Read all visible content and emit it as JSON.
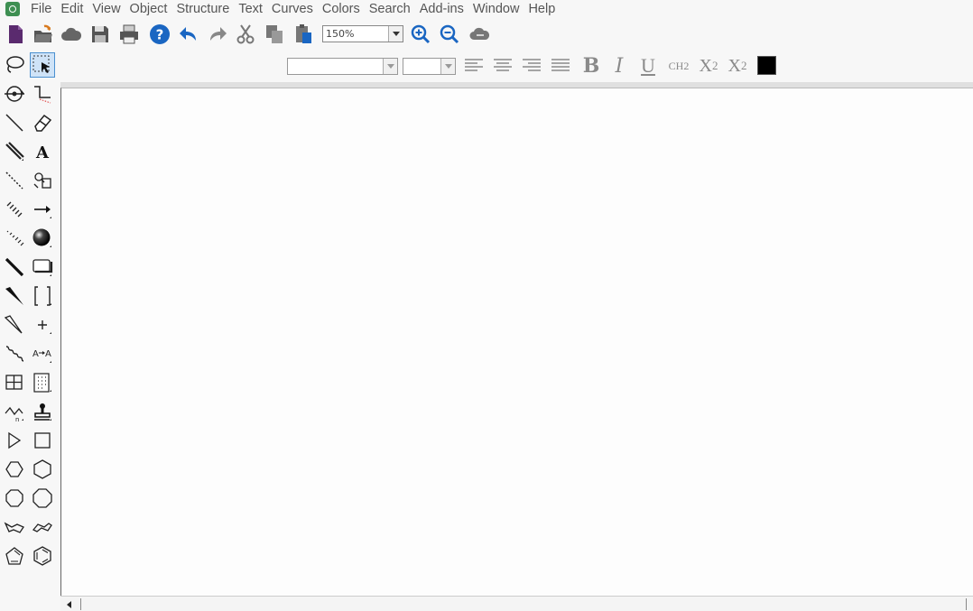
{
  "menu": {
    "items": [
      "File",
      "Edit",
      "View",
      "Object",
      "Structure",
      "Text",
      "Curves",
      "Colors",
      "Search",
      "Add-ins",
      "Window",
      "Help"
    ]
  },
  "toolbar": {
    "zoom_value": "150%"
  },
  "colors": {
    "accent_blue": "#1a66c2",
    "selected_tool_bg": "#cfe3f7",
    "text_color_swatch": "#000000",
    "new_doc_purple": "#5a2a6e"
  },
  "icons": {
    "toolbar": [
      "new-document-icon",
      "open-icon",
      "cloud-icon",
      "save-icon",
      "print-icon",
      "help-icon",
      "undo-icon",
      "redo-icon",
      "cut-icon",
      "copy-icon",
      "paste-icon",
      "zoom-in-icon",
      "zoom-out-icon",
      "cloud-sync-icon"
    ],
    "format": [
      "align-left-icon",
      "align-center-icon",
      "align-right-icon",
      "align-justify-icon"
    ],
    "palette": [
      "lasso-icon",
      "marquee-select-icon",
      "rotate-icon",
      "bond-chain-icon",
      "line-icon",
      "eraser-icon",
      "double-bond-icon",
      "text-icon",
      "dashed-bond-icon",
      "element-lookup-icon",
      "hashed-bond-icon",
      "arrow-icon",
      "hashed-wedge-icon",
      "orbital-sphere-icon",
      "bold-bond-icon",
      "drawing-shape-icon",
      "wedge-bond-icon",
      "bracket-icon",
      "hollow-wedge-icon",
      "charge-plus-icon",
      "wavy-bond-icon",
      "atom-map-icon",
      "table-icon",
      "template-grid-icon",
      "acyclic-chain-icon",
      "stamp-icon",
      "cyclopropane-icon",
      "cyclobutane-icon",
      "cyclopentane-icon",
      "cyclohexane-icon",
      "cycloheptane-icon",
      "cyclooctane-icon",
      "cyclohexane-chair-icon-1",
      "cyclohexane-chair-icon-2",
      "cyclopentadiene-icon",
      "benzene-icon"
    ]
  },
  "format": {
    "bold": "B",
    "italic": "I",
    "underline": "U",
    "chem_style": "CH2",
    "subscript_base": "X",
    "subscript_num": "2",
    "superscript_base": "X",
    "superscript_num": "2"
  }
}
